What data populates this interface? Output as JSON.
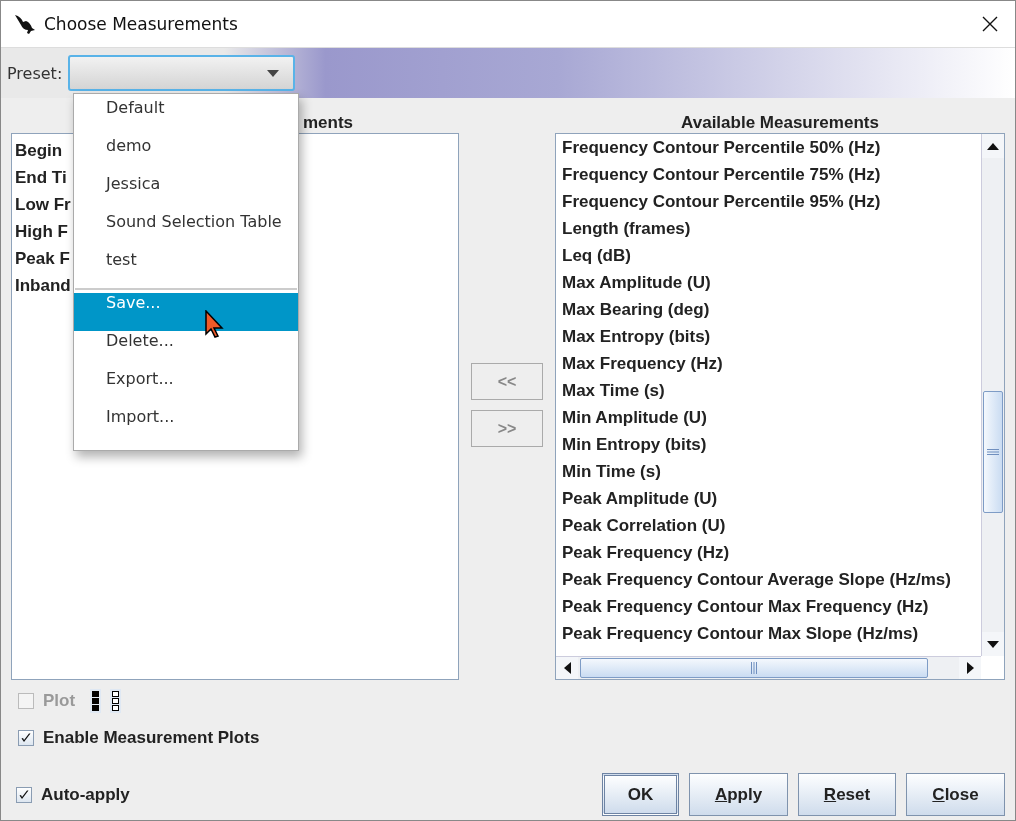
{
  "window": {
    "title": "Choose Measurements"
  },
  "preset": {
    "label": "Preset:",
    "expanded": true
  },
  "preset_menu": {
    "items": [
      {
        "kind": "item",
        "label": "Default",
        "selected": false
      },
      {
        "kind": "item",
        "label": "demo",
        "selected": false
      },
      {
        "kind": "item",
        "label": "Jessica",
        "selected": false
      },
      {
        "kind": "item",
        "label": "Sound Selection Table",
        "selected": false
      },
      {
        "kind": "item",
        "label": "test",
        "selected": false
      },
      {
        "kind": "separator"
      },
      {
        "kind": "item",
        "label": "Save...",
        "selected": true
      },
      {
        "kind": "item",
        "label": "Delete...",
        "selected": false
      },
      {
        "kind": "item",
        "label": "Export...",
        "selected": false
      },
      {
        "kind": "item",
        "label": "Import...",
        "selected": false
      }
    ]
  },
  "selected_panel": {
    "heading": "ments",
    "items": [
      "Begin",
      "End Ti",
      "Low Fr",
      "High F",
      "Peak F",
      "Inband"
    ]
  },
  "move_buttons": [
    {
      "label": "<<",
      "disabled": true
    },
    {
      "label": ">>",
      "disabled": true
    }
  ],
  "available_panel": {
    "heading": "Available Measurements",
    "items": [
      "Frequency Contour Percentile 50% (Hz)",
      "Frequency Contour Percentile 75% (Hz)",
      "Frequency Contour Percentile 95% (Hz)",
      "Length (frames)",
      "Leq (dB)",
      "Max Amplitude (U)",
      "Max Bearing (deg)",
      "Max Entropy (bits)",
      "Max Frequency (Hz)",
      "Max Time (s)",
      "Min Amplitude (U)",
      "Min Entropy (bits)",
      "Min Time (s)",
      "Peak Amplitude (U)",
      "Peak Correlation (U)",
      "Peak Frequency (Hz)",
      "Peak Frequency Contour Average Slope (Hz/ms)",
      "Peak Frequency Contour Max Frequency (Hz)",
      "Peak Frequency Contour Max Slope (Hz/ms)"
    ]
  },
  "plot": {
    "label": "Plot",
    "checked": false,
    "disabled": true
  },
  "enable_plots": {
    "label": "Enable Measurement Plots",
    "checked": true,
    "disabled": false
  },
  "auto_apply": {
    "label": "Auto-apply",
    "checked": true,
    "disabled": false
  },
  "buttons": [
    {
      "label": "OK",
      "default": true,
      "underline_first": false
    },
    {
      "label": "Apply",
      "default": false,
      "underline_first": true
    },
    {
      "label": "Reset",
      "default": false,
      "underline_first": true
    },
    {
      "label": "Close",
      "default": false,
      "underline_first": true
    }
  ]
}
